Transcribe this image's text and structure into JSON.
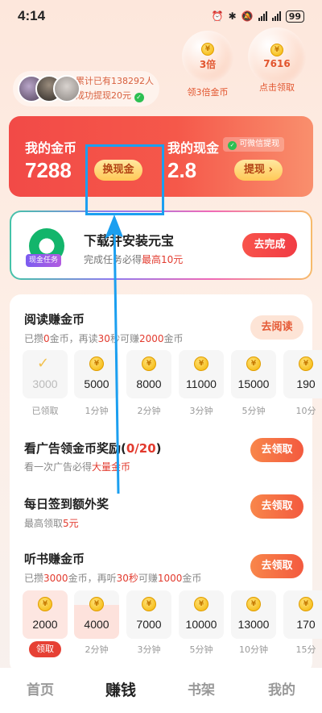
{
  "status": {
    "time": "4:14",
    "battery": "99"
  },
  "top": {
    "stat_line1": "累计已有138292人",
    "stat_line2": "成功提现20元",
    "bubble1": {
      "value": "3倍",
      "caption": "领3倍金币"
    },
    "bubble2": {
      "value": "7616",
      "caption": "点击领取"
    }
  },
  "wallet": {
    "coins_label": "我的金币",
    "coins_value": "7288",
    "exchange_button": "换现金",
    "cash_label": "我的现金",
    "wechat_tag": "可微信提现",
    "cash_value": "2.8",
    "withdraw_button": "提现 ›"
  },
  "task": {
    "title": "下载并安装元宝",
    "tag": "现金任务",
    "sub_prefix": "完成任务必得",
    "sub_highlight": "最高10元",
    "button": "去完成"
  },
  "reading": {
    "title": "阅读赚金币",
    "sub": [
      "已攒",
      "0",
      "金币，再读",
      "30",
      "秒可赚",
      "2000",
      "金币"
    ],
    "button": "去阅读",
    "rewards": [
      {
        "value": "3000",
        "caption": "已领取"
      },
      {
        "value": "5000",
        "caption": "1分钟"
      },
      {
        "value": "8000",
        "caption": "2分钟"
      },
      {
        "value": "11000",
        "caption": "3分钟"
      },
      {
        "value": "15000",
        "caption": "5分钟"
      },
      {
        "value": "190",
        "caption": "10分"
      }
    ]
  },
  "ads": {
    "title_prefix": "看广告领金币奖励(",
    "title_count": "0/20",
    "title_suffix": ")",
    "sub_prefix": "看一次广告必得",
    "sub_highlight": "大量金币",
    "button": "去领取"
  },
  "signin": {
    "title": "每日签到额外奖",
    "sub_prefix": "最高领取",
    "sub_highlight": "5元",
    "button": "去领取"
  },
  "audio": {
    "title": "听书赚金币",
    "sub": [
      "已攒",
      "3000",
      "金币，再听",
      "30秒",
      "可赚",
      "1000",
      "金币"
    ],
    "button": "去领取",
    "claim_badge": "领取",
    "rewards": [
      {
        "value": "2000",
        "caption": ""
      },
      {
        "value": "4000",
        "caption": "2分钟"
      },
      {
        "value": "7000",
        "caption": "3分钟"
      },
      {
        "value": "10000",
        "caption": "5分钟"
      },
      {
        "value": "13000",
        "caption": "10分钟"
      },
      {
        "value": "170",
        "caption": "15分"
      }
    ]
  },
  "nav": {
    "home": "首页",
    "earn": "赚钱",
    "shelf": "书架",
    "mine": "我的"
  }
}
